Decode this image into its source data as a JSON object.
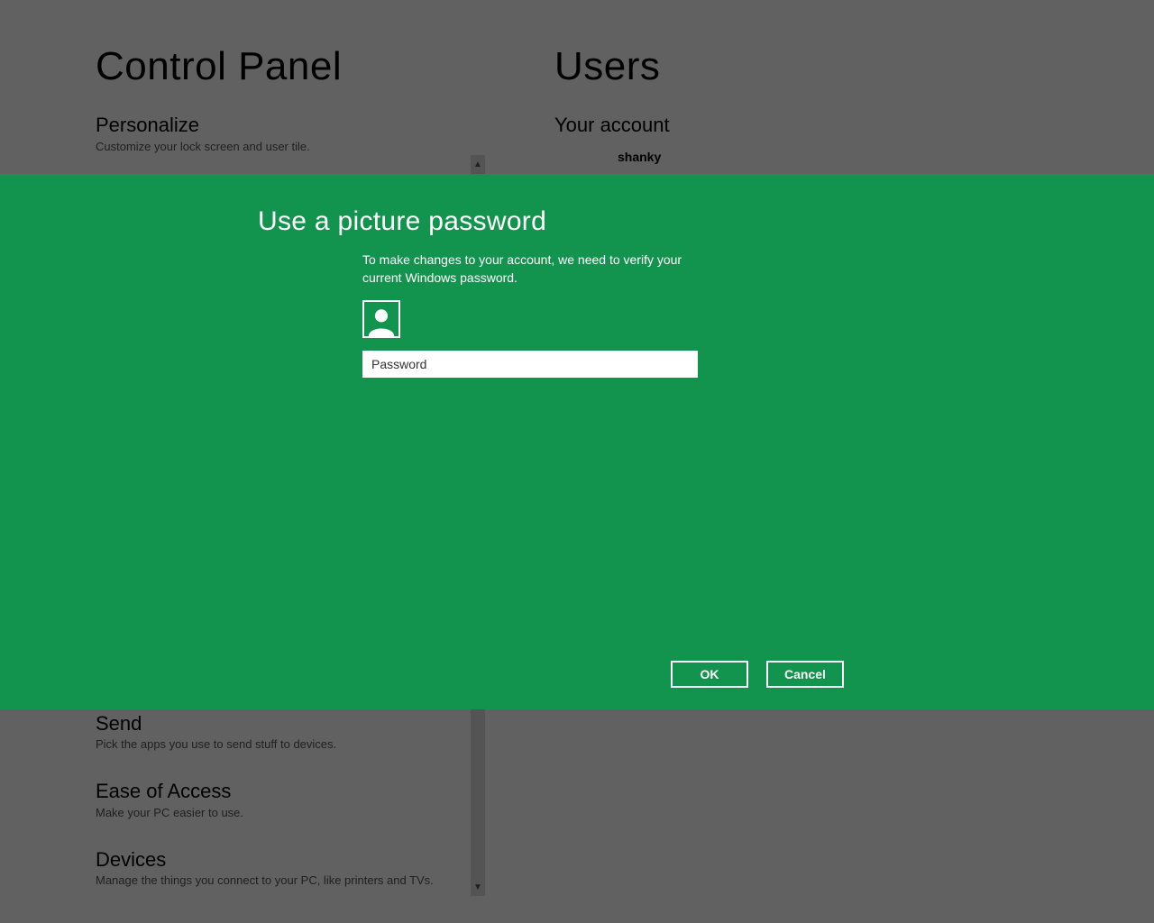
{
  "background": {
    "left_title": "Control Panel",
    "right_title": "Users",
    "your_account_label": "Your account",
    "account_name": "shanky",
    "options": [
      {
        "title": "Personalize",
        "sub": "Customize your lock screen and user tile."
      },
      {
        "title": "Send",
        "sub": "Pick the apps you use to send stuff to devices."
      },
      {
        "title": "Ease of Access",
        "sub": "Make your PC easier to use."
      },
      {
        "title": "Devices",
        "sub": "Manage the things you connect to your PC, like printers and TVs."
      }
    ]
  },
  "modal": {
    "title": "Use a picture password",
    "body": "To make changes to your account, we need to verify your current Windows password.",
    "username": "",
    "password_placeholder": "Password",
    "ok_label": "OK",
    "cancel_label": "Cancel",
    "accent_color": "#13944e"
  }
}
